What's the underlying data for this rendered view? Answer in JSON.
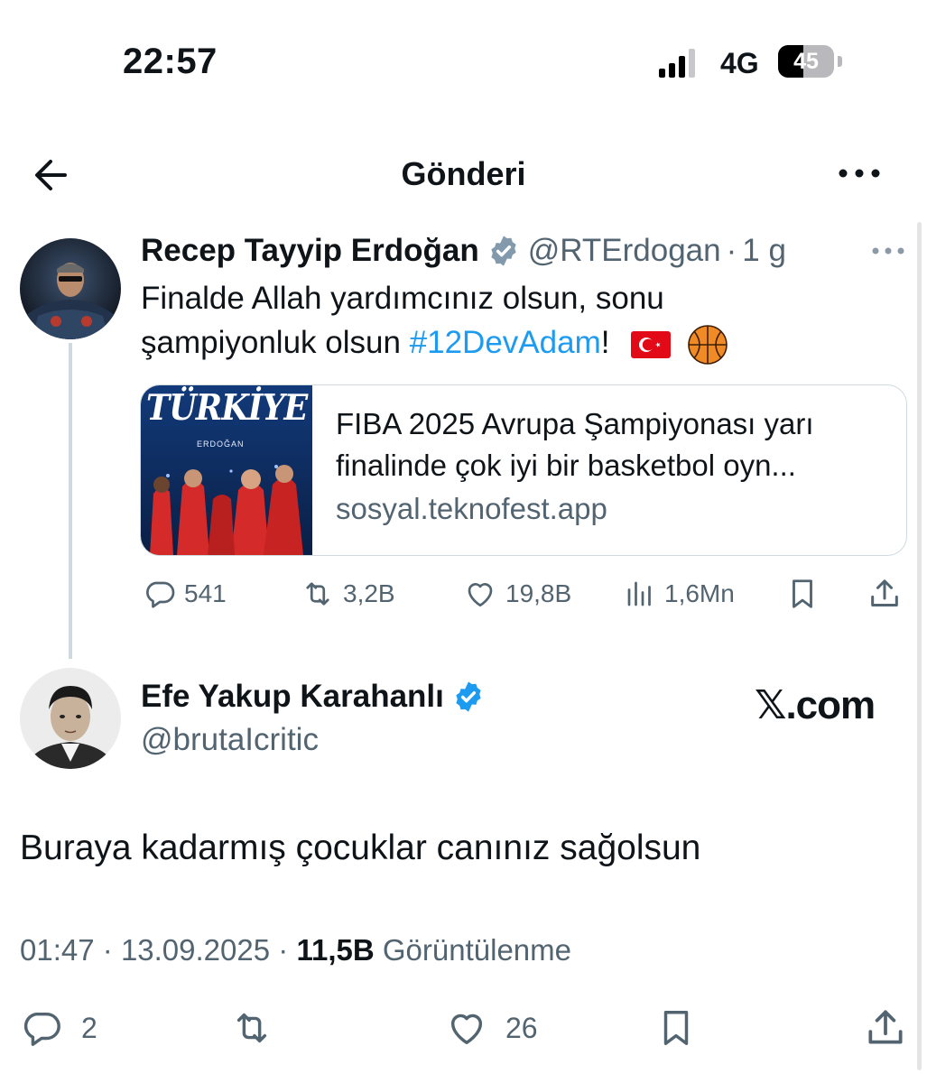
{
  "status_bar": {
    "time": "22:57",
    "network": "4G",
    "battery_level": "45",
    "battery_fraction": 0.45,
    "signal_bars_active": 3,
    "signal_bars_total": 4
  },
  "nav": {
    "title": "Gönderi",
    "back_icon": "arrow-left-icon",
    "more_icon": "more-horizontal-icon"
  },
  "main_tweet": {
    "author_name": "Recep Tayyip Erdoğan",
    "verified_color": "#829aab",
    "handle": "@RTErdogan",
    "separator": "·",
    "age": "1 g",
    "text_line1": "Finalde Allah yardımcınız olsun, sonu",
    "text_line2_prefix": "şampiyonluk olsun ",
    "hashtag": "#12DevAdam",
    "text_line2_suffix": "!",
    "emojis": [
      "turkey-flag-emoji",
      "basketball-emoji"
    ],
    "card": {
      "image_title": "TÜRKİYE",
      "image_caption": "ERDOĞAN",
      "title": "FIBA 2025 Avrupa Şampiyonası yarı finalinde çok iyi bir basketbol oyn...",
      "domain": "sosyal.teknofest.app"
    },
    "stats": {
      "replies": "541",
      "retweets": "3,2B",
      "likes": "19,8B",
      "views": "1,6Mn"
    }
  },
  "reply_tweet": {
    "author_name": "Efe Yakup Karahanlı",
    "verified_color": "#1d9bf0",
    "handle": "@brutaIcritic",
    "watermark": "𝕏.com",
    "text": "Buraya kadarmış çocuklar canınız sağolsun",
    "time": "01:47",
    "date": "13.09.2025",
    "separator": "·",
    "views_count": "11,5B",
    "views_label": "Görüntülenme",
    "stats": {
      "replies": "2",
      "likes": "26"
    }
  },
  "colors": {
    "accent": "#1d9bf0",
    "secondary_text": "#536471",
    "primary_text": "#0f1419",
    "border": "#cfd9de"
  }
}
